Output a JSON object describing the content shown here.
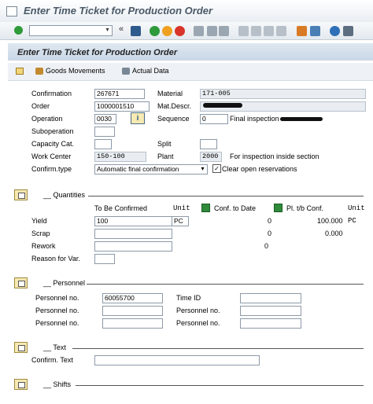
{
  "window": {
    "title": "Enter Time Ticket for Production Order"
  },
  "toolbar": {
    "command_value": "",
    "nav_back": "«"
  },
  "screen": {
    "title": "Enter Time Ticket for Production Order"
  },
  "app_toolbar": {
    "goods_movements": "Goods Movements",
    "actual_data": "Actual Data"
  },
  "header": {
    "confirmation_label": "Confirmation",
    "confirmation_value": "267671",
    "material_label": "Material",
    "material_value": "171-005",
    "order_label": "Order",
    "order_value": "1000001510",
    "matdescr_label": "Mat.Descr.",
    "operation_label": "Operation",
    "operation_value": "0030",
    "sequence_label": "Sequence",
    "sequence_value": "0",
    "final_inspection_label": "Final inspection",
    "suboperation_label": "Suboperation",
    "capacity_label": "Capacity Cat.",
    "split_label": "Split",
    "work_center_label": "Work Center",
    "work_center_value": "150-100",
    "plant_label": "Plant",
    "plant_value": "2000",
    "inspection_text": "For inspection inside section",
    "confirm_type_label": "Confirm.type",
    "confirm_type_value": "Automatic final confirmation",
    "clear_reservations_label": "Clear open reservations",
    "clear_reservations_checked": true
  },
  "quantities": {
    "title": "__ Quantities",
    "col_to_be_confirmed": "To Be Confirmed",
    "col_unit": "Unit",
    "col_conf_to_date": "Conf. to Date",
    "col_pl_tb_conf": "Pl. t/b Conf.",
    "col_unit2": "Unit",
    "yield_label": "Yield",
    "yield_value": "100",
    "yield_unit": "PC",
    "yield_conf_to_date": "0",
    "yield_planned": "100.000",
    "yield_unit2": "PC",
    "scrap_label": "Scrap",
    "scrap_conf_to_date": "0",
    "scrap_planned": "0.000",
    "rework_label": "Rework",
    "rework_conf_to_date": "0",
    "reason_label": "Reason for Var."
  },
  "personnel": {
    "title": "__ Personnel",
    "personnel_no_label": "Personnel no.",
    "personnel_no_1": "60055700",
    "time_id_label": "Time ID"
  },
  "text_section": {
    "title": "__ Text",
    "confirm_text_label": "Confirm. Text"
  },
  "shifts": {
    "title": "__ Shifts"
  }
}
